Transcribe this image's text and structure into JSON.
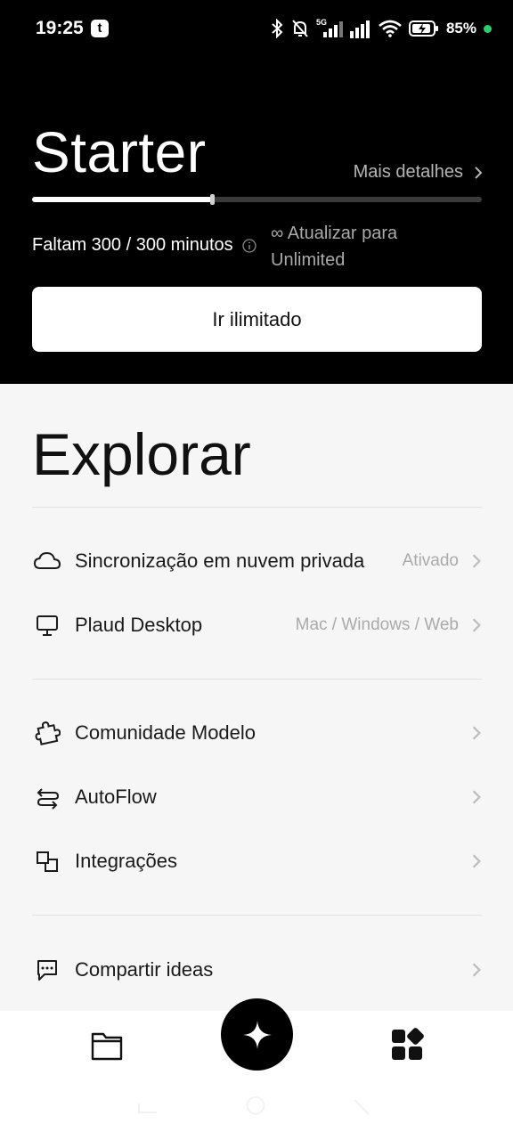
{
  "status_bar": {
    "time": "19:25",
    "app_icon_letter": "t",
    "battery_percent": "85%",
    "network_label": "5G",
    "icons": [
      "bluetooth-icon",
      "bell-off-icon",
      "signal-5g-icon",
      "signal-icon",
      "wifi-icon",
      "battery-charging-icon"
    ]
  },
  "plan": {
    "name": "Starter",
    "more_details": "Mais detalhes",
    "progress_fraction": 0.4,
    "minutes_text": "Faltam 300 / 300 minutos",
    "upgrade_text": "∞ Atualizar para Unlimited",
    "cta_label": "Ir ilimitado"
  },
  "explore": {
    "title": "Explorar",
    "group1": [
      {
        "icon": "cloud-icon",
        "label": "Sincronização em nuvem privada",
        "value": "Ativado"
      },
      {
        "icon": "monitor-icon",
        "label": "Plaud Desktop",
        "value": "Mac / Windows / Web"
      }
    ],
    "group2": [
      {
        "icon": "puzzle-icon",
        "label": "Comunidade Modelo",
        "value": ""
      },
      {
        "icon": "autoflow-icon",
        "label": "AutoFlow",
        "value": ""
      },
      {
        "icon": "integrations-icon",
        "label": "Integrações",
        "value": ""
      }
    ],
    "group3": [
      {
        "icon": "chat-icon",
        "label": "Compartir ideas",
        "value": ""
      }
    ]
  },
  "bottom_nav": {
    "items": [
      "folder-icon",
      "plus-icon",
      "apps-icon"
    ]
  },
  "colors": {
    "top_background": "#000000",
    "page_background": "#f6f6f6",
    "status_dot": "#2ecc71"
  }
}
